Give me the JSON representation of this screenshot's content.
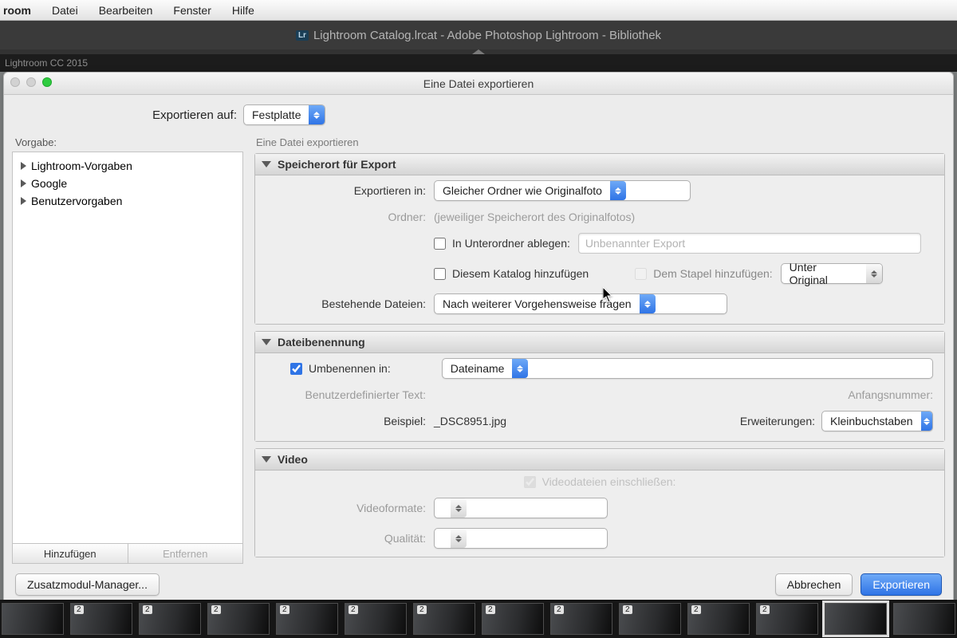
{
  "menubar": {
    "app": "room",
    "items": [
      "Datei",
      "Bearbeiten",
      "Fenster",
      "Hilfe"
    ]
  },
  "docTitle": "Lightroom Catalog.lrcat - Adobe Photoshop Lightroom - Bibliothek",
  "blackStrip": "Lightroom CC 2015",
  "dialog": {
    "title": "Eine Datei exportieren",
    "exportToLabel": "Exportieren auf:",
    "exportToValue": "Festplatte",
    "presetLabel": "Vorgabe:",
    "presets": [
      "Lightroom-Vorgaben",
      "Google",
      "Benutzervorgaben"
    ],
    "presetAdd": "Hinzufügen",
    "presetRemove": "Entfernen",
    "mainSub": "Eine Datei exportieren",
    "section1": {
      "title": "Speicherort für Export",
      "exportInLabel": "Exportieren in:",
      "exportInValue": "Gleicher Ordner wie Originalfoto",
      "folderLabel": "Ordner:",
      "folderValue": "(jeweiliger Speicherort des Originalfotos)",
      "subfolderLabel": "In Unterordner ablegen:",
      "subfolderPlaceholder": "Unbenannter Export",
      "addCatalog": "Diesem Katalog hinzufügen",
      "addStackLabel": "Dem Stapel hinzufügen:",
      "addStackValue": "Unter Original",
      "existingLabel": "Bestehende Dateien:",
      "existingValue": "Nach weiterer Vorgehensweise fragen"
    },
    "section2": {
      "title": "Dateibenennung",
      "renameLabel": "Umbenennen in:",
      "renameValue": "Dateiname",
      "customTextLabel": "Benutzerdefinierter Text:",
      "startNumLabel": "Anfangsnummer:",
      "exampleLabel": "Beispiel:",
      "exampleValue": "_DSC8951.jpg",
      "extLabel": "Erweiterungen:",
      "extValue": "Kleinbuchstaben"
    },
    "section3": {
      "title": "Video",
      "includeLabel": "Videodateien einschließen:",
      "formatLabel": "Videoformate:",
      "qualityLabel": "Qualität:"
    },
    "pluginBtn": "Zusatzmodul-Manager...",
    "cancel": "Abbrechen",
    "export": "Exportieren"
  },
  "thumbBadge": "2"
}
